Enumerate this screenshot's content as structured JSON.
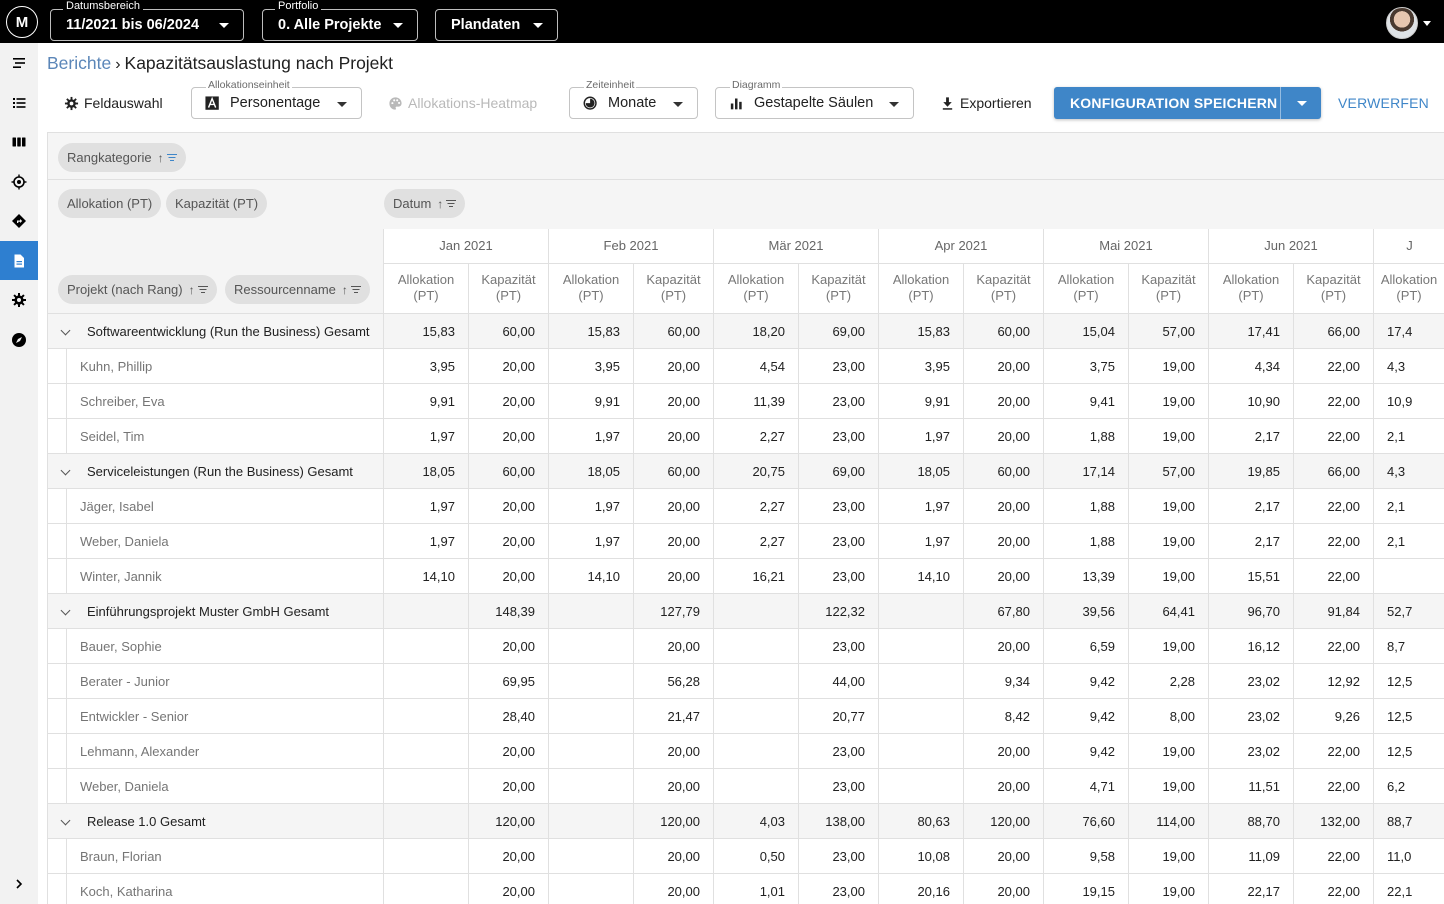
{
  "topbar": {
    "date_range": {
      "label": "Datumsbereich",
      "value": "11/2021 bis 06/2024"
    },
    "portfolio": {
      "label": "Portfolio",
      "value": "0. Alle Projekte"
    },
    "data_type": {
      "value": "Plandaten"
    },
    "logo_text": "M"
  },
  "breadcrumb": {
    "parent": "Berichte",
    "separator": "›",
    "current": "Kapazitätsauslastung nach Projekt"
  },
  "toolbar": {
    "field_select": "Feldauswahl",
    "allocation_unit": {
      "label": "Allokationseinheit",
      "value": "Personentage"
    },
    "heatmap": "Allokations-Heatmap",
    "time_unit": {
      "label": "Zeiteinheit",
      "value": "Monate"
    },
    "diagram": {
      "label": "Diagramm",
      "value": "Gestapelte Säulen"
    },
    "export": "Exportieren",
    "save_config": "KONFIGURATION SPEICHERN",
    "discard": "VERWERFEN"
  },
  "pivot": {
    "filter_chips": [
      {
        "label": "Rangkategorie",
        "sort": "↑"
      }
    ],
    "value_chips": [
      {
        "label": "Allokation (PT)"
      },
      {
        "label": "Kapazität (PT)"
      }
    ],
    "column_chips": [
      {
        "label": "Datum",
        "sort": "↑"
      }
    ],
    "row_chips": [
      {
        "label": "Projekt (nach Rang)",
        "sort": "↑"
      },
      {
        "label": "Ressourcenname",
        "sort": "↑"
      }
    ],
    "months": [
      "Jan 2021",
      "Feb 2021",
      "Mär 2021",
      "Apr 2021",
      "Mai 2021",
      "Jun 2021",
      "J"
    ],
    "sub_headers": [
      "Allokation\n(PT)",
      "Kapazität\n(PT)"
    ],
    "rows": [
      {
        "type": "group",
        "label": "Softwareentwicklung (Run the Business) Gesamt",
        "values": [
          "15,83",
          "60,00",
          "15,83",
          "60,00",
          "18,20",
          "69,00",
          "15,83",
          "60,00",
          "15,04",
          "57,00",
          "17,41",
          "66,00",
          "17,4"
        ]
      },
      {
        "type": "item",
        "label": "Kuhn, Phillip",
        "values": [
          "3,95",
          "20,00",
          "3,95",
          "20,00",
          "4,54",
          "23,00",
          "3,95",
          "20,00",
          "3,75",
          "19,00",
          "4,34",
          "22,00",
          "4,3"
        ]
      },
      {
        "type": "item",
        "label": "Schreiber, Eva",
        "values": [
          "9,91",
          "20,00",
          "9,91",
          "20,00",
          "11,39",
          "23,00",
          "9,91",
          "20,00",
          "9,41",
          "19,00",
          "10,90",
          "22,00",
          "10,9"
        ]
      },
      {
        "type": "item",
        "label": "Seidel, Tim",
        "values": [
          "1,97",
          "20,00",
          "1,97",
          "20,00",
          "2,27",
          "23,00",
          "1,97",
          "20,00",
          "1,88",
          "19,00",
          "2,17",
          "22,00",
          "2,1"
        ]
      },
      {
        "type": "group",
        "label": "Serviceleistungen (Run the Business) Gesamt",
        "values": [
          "18,05",
          "60,00",
          "18,05",
          "60,00",
          "20,75",
          "69,00",
          "18,05",
          "60,00",
          "17,14",
          "57,00",
          "19,85",
          "66,00",
          "4,3"
        ]
      },
      {
        "type": "item",
        "label": "Jäger, Isabel",
        "values": [
          "1,97",
          "20,00",
          "1,97",
          "20,00",
          "2,27",
          "23,00",
          "1,97",
          "20,00",
          "1,88",
          "19,00",
          "2,17",
          "22,00",
          "2,1"
        ]
      },
      {
        "type": "item",
        "label": "Weber, Daniela",
        "values": [
          "1,97",
          "20,00",
          "1,97",
          "20,00",
          "2,27",
          "23,00",
          "1,97",
          "20,00",
          "1,88",
          "19,00",
          "2,17",
          "22,00",
          "2,1"
        ]
      },
      {
        "type": "item",
        "label": "Winter, Jannik",
        "values": [
          "14,10",
          "20,00",
          "14,10",
          "20,00",
          "16,21",
          "23,00",
          "14,10",
          "20,00",
          "13,39",
          "19,00",
          "15,51",
          "22,00",
          ""
        ]
      },
      {
        "type": "group",
        "label": "Einführungsprojekt Muster GmbH Gesamt",
        "values": [
          "",
          "148,39",
          "",
          "127,79",
          "",
          "122,32",
          "",
          "67,80",
          "39,56",
          "64,41",
          "96,70",
          "91,84",
          "52,7"
        ]
      },
      {
        "type": "item",
        "label": "Bauer, Sophie",
        "values": [
          "",
          "20,00",
          "",
          "20,00",
          "",
          "23,00",
          "",
          "20,00",
          "6,59",
          "19,00",
          "16,12",
          "22,00",
          "8,7"
        ]
      },
      {
        "type": "item",
        "label": "Berater - Junior",
        "values": [
          "",
          "69,95",
          "",
          "56,28",
          "",
          "44,00",
          "",
          "9,34",
          "9,42",
          "2,28",
          "23,02",
          "12,92",
          "12,5"
        ]
      },
      {
        "type": "item",
        "label": "Entwickler - Senior",
        "values": [
          "",
          "28,40",
          "",
          "21,47",
          "",
          "20,77",
          "",
          "8,42",
          "9,42",
          "8,00",
          "23,02",
          "9,26",
          "12,5"
        ]
      },
      {
        "type": "item",
        "label": "Lehmann, Alexander",
        "values": [
          "",
          "20,00",
          "",
          "20,00",
          "",
          "23,00",
          "",
          "20,00",
          "9,42",
          "19,00",
          "23,02",
          "22,00",
          "12,5"
        ]
      },
      {
        "type": "item",
        "label": "Weber, Daniela",
        "values": [
          "",
          "20,00",
          "",
          "20,00",
          "",
          "23,00",
          "",
          "20,00",
          "4,71",
          "19,00",
          "11,51",
          "22,00",
          "6,2"
        ]
      },
      {
        "type": "group",
        "label": "Release 1.0 Gesamt",
        "values": [
          "",
          "120,00",
          "",
          "120,00",
          "4,03",
          "138,00",
          "80,63",
          "120,00",
          "76,60",
          "114,00",
          "88,70",
          "132,00",
          "88,7"
        ]
      },
      {
        "type": "item",
        "label": "Braun, Florian",
        "values": [
          "",
          "20,00",
          "",
          "20,00",
          "0,50",
          "23,00",
          "10,08",
          "20,00",
          "9,58",
          "19,00",
          "11,09",
          "22,00",
          "11,0"
        ]
      },
      {
        "type": "item",
        "label": "Koch, Katharina",
        "values": [
          "",
          "20,00",
          "",
          "20,00",
          "1,01",
          "23,00",
          "20,16",
          "20,00",
          "19,15",
          "19,00",
          "22,17",
          "22,00",
          "22,1"
        ]
      }
    ]
  },
  "sidebar": {
    "items": [
      {
        "icon": "menu-collapse-icon"
      },
      {
        "icon": "list-icon"
      },
      {
        "icon": "columns-icon"
      },
      {
        "icon": "target-icon"
      },
      {
        "icon": "directions-icon"
      },
      {
        "icon": "report-icon",
        "active": true
      },
      {
        "icon": "settings-icon"
      },
      {
        "icon": "compass-icon"
      },
      {
        "icon": "chevron-right-icon"
      }
    ]
  },
  "colors": {
    "accent": "#3f86c8",
    "active_sidebar": "#2e7fd0",
    "link": "#5b86b8"
  }
}
